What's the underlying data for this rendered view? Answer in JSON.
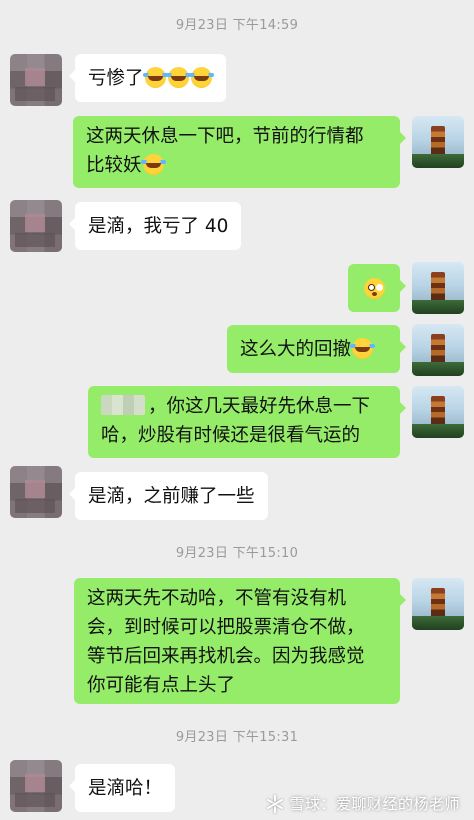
{
  "timestamps": [
    "9月23日 下午14:59",
    "9月23日 下午15:10",
    "9月23日 下午15:31"
  ],
  "messages": [
    {
      "text": "亏惨了"
    },
    {
      "line1": "这两天休息一下吧，节前的行情都",
      "line2": "比较妖"
    },
    {
      "text": "是滴，我亏了 40"
    },
    {
      "text": ""
    },
    {
      "text": "这么大的回撤"
    },
    {
      "line1": "，你这几天最好先休息一下",
      "line2": "哈，炒股有时候还是很看气运的"
    },
    {
      "text": "是滴，之前赚了一些"
    },
    {
      "line1": "这两天先不动哈，不管有没有机",
      "line2": "会，到时候可以把股票清仓不做，",
      "line3": "等节后回来再找机会。因为我感觉",
      "line4": "你可能有点上头了"
    },
    {
      "text": "是滴哈！"
    }
  ],
  "emoji": {
    "cry": "laugh-cry-emoji",
    "shock": "astonished-emoji"
  },
  "watermark": {
    "text": "雪球：爱聊财经的杨老师"
  },
  "colors": {
    "background": "#ededed",
    "outgoing": "#95ec69",
    "incoming": "#ffffff",
    "timestamp": "#9a9a9a"
  }
}
